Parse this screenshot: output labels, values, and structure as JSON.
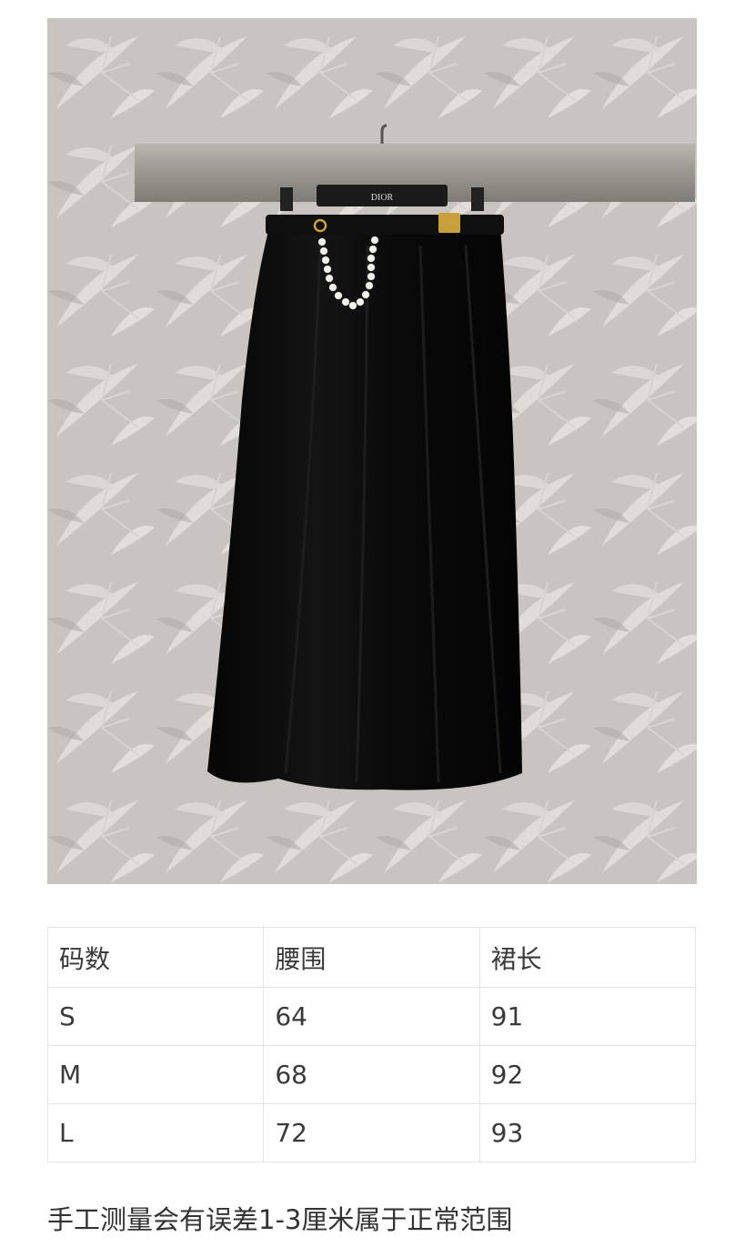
{
  "photo": {
    "hanger_brand": "DIOR",
    "subject": "skirt-on-hanger",
    "colors": {
      "wall": "#cbc6c2",
      "wall_leaf": "#e8e5e2",
      "rail": "#9a9791",
      "skirt": "#0b0b0c",
      "gold": "#c9a13c",
      "pearl": "#f4f1ea"
    }
  },
  "size_table": {
    "headers": [
      "码数",
      "腰围",
      "裙长"
    ],
    "rows": [
      [
        "S",
        "64",
        "91"
      ],
      [
        "M",
        "68",
        "92"
      ],
      [
        "L",
        "72",
        "93"
      ]
    ]
  },
  "note": "手工测量会有误差1-3厘米属于正常范围"
}
